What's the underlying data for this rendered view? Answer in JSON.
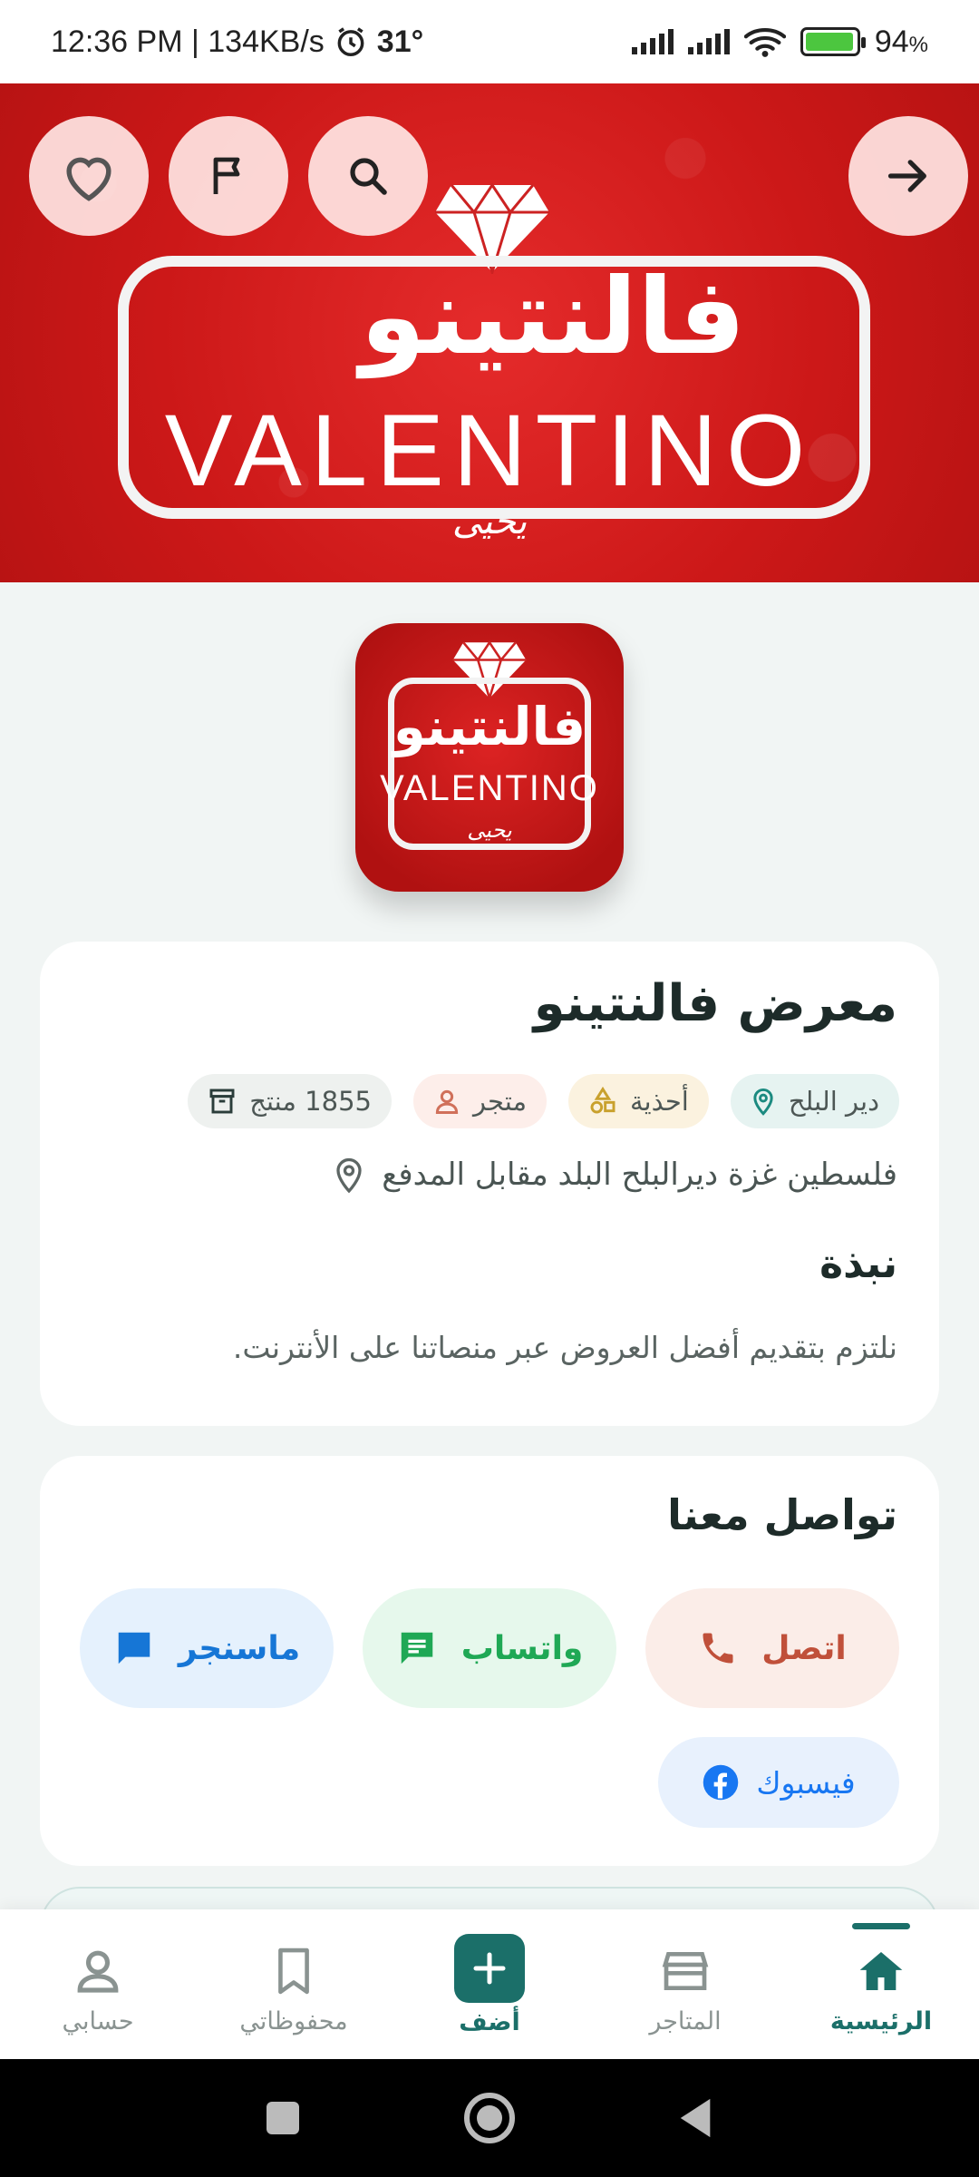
{
  "status_bar": {
    "time_speed": "12:36 PM | 134KB/s",
    "temperature": "31°",
    "battery_percent": "94",
    "battery_suffix": "%"
  },
  "banner": {
    "arabic_name": "فالنتينو",
    "latin_name": "VALENTINO",
    "signature": "يحيى"
  },
  "store": {
    "name": "معرض فالنتينو",
    "chips": {
      "location": "دير البلح",
      "category": "أحذية",
      "type": "متجر",
      "products": "1855 منتج"
    },
    "address": "فلسطين غزة ديرالبلح البلد مقابل المدفع",
    "about_title": "نبذة",
    "about_text": "نلتزم بتقديم أفضل العروض عبر منصاتنا على الأنترنت."
  },
  "contact": {
    "title": "تواصل معنا",
    "call_label": "اتصل",
    "whatsapp_label": "واتساب",
    "messenger_label": "ماسنجر",
    "facebook_label": "فيسبوك"
  },
  "nav": {
    "home": "الرئيسية",
    "stores": "المتاجر",
    "add": "أضف",
    "saved": "محفوظاتي",
    "account": "حسابي"
  },
  "colors": {
    "brand": "#1b6f69",
    "banner_red": "#d91f1f",
    "call": "#c0503a",
    "whatsapp": "#1fa855",
    "messenger": "#1676d6",
    "facebook": "#1877f2"
  },
  "icons": {
    "favorite": "heart-icon",
    "report": "flag-icon",
    "search": "search-icon",
    "back": "arrow-right-icon"
  }
}
